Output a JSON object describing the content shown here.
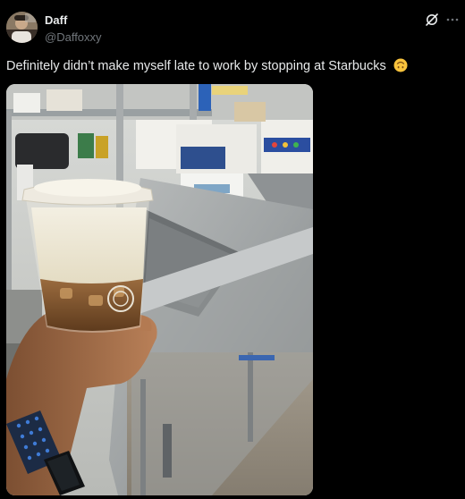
{
  "author": {
    "display_name": "Daff",
    "handle": "@Daffoxxy"
  },
  "post": {
    "text": "Definitely didn’t make myself late to work by stopping at Starbucks",
    "emoji_icon": "upside-down-face-icon"
  },
  "actions": {
    "grok_icon": "grok-icon",
    "more_icon": "more-icon"
  },
  "colors": {
    "background": "#000000",
    "text_primary": "#e7e9ea",
    "text_secondary": "#71767b"
  }
}
